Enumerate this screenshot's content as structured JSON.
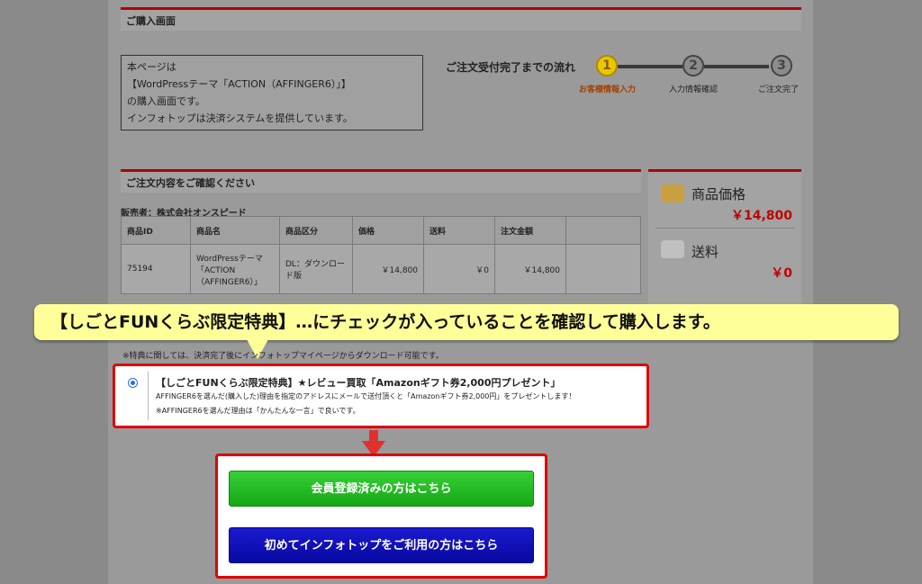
{
  "purchase_header": "ご購入画面",
  "info_lines": [
    "本ページは",
    "【WordPressテーマ「ACTION（AFFINGER6）」】",
    "の購入画面です。",
    "インフォトップは決済システムを提供しています。"
  ],
  "flow": {
    "title": "ご注文受付完了までの流れ",
    "steps": [
      {
        "num": "1",
        "label": "お客様情報入力"
      },
      {
        "num": "2",
        "label": "入力情報確認"
      },
      {
        "num": "3",
        "label": "ご注文完了"
      }
    ]
  },
  "order_header": "ご注文内容をご確認ください",
  "seller": "販売者：株式会社オンスピード",
  "table": {
    "headers": [
      "商品ID",
      "商品名",
      "商品区分",
      "価格",
      "送料",
      "注文金額"
    ],
    "row": {
      "id": "75194",
      "name": "WordPressテーマ「ACTION（AFFINGER6）」",
      "category": "DL：ダウンロード版",
      "price": "￥14,800",
      "shipping": "￥0",
      "total": "￥14,800"
    }
  },
  "summary": {
    "price_label": "商品価格",
    "price_value": "￥14,800",
    "shipping_label": "送料",
    "shipping_value": "￥0"
  },
  "callout": "【しごとFUNくらぶ限定特典】…にチェックが入っていることを確認して購入します。",
  "note": "※特典に関しては、決済完了後にインフォトップマイページからダウンロード可能です。",
  "offer": {
    "title": "【しごとFUNくらぶ限定特典】★レビュー買取「Amazonギフト券2,000円プレゼント」",
    "desc1": "AFFINGER6を選んだ(購入した)理由を指定のアドレスにメールで送付頂くと「Amazonギフト券2,000円」をプレゼントします！",
    "desc2": "※AFFINGER6を選んだ理由は「かんたんな一言」で良いです。"
  },
  "buttons": {
    "member": "会員登録済みの方はこちら",
    "first_time": "初めてインフォトップをご利用の方はこちら"
  },
  "colors": {
    "accent_red": "#e00000",
    "step_active": "#d4b000",
    "button_green": "#14a814",
    "button_blue": "#0808a0"
  }
}
